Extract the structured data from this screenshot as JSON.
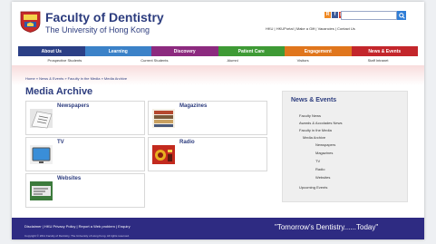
{
  "header": {
    "title": "Faculty of Dentistry",
    "subtitle": "The University of Hong Kong",
    "social_icons": [
      "rss-icon",
      "facebook-icon",
      "youtube-icon"
    ],
    "search_placeholder": "",
    "top_links": "HKU | HKUPortal | Make a Gift | Vacancies | Contact Us"
  },
  "nav": [
    {
      "label": "About Us",
      "color": "#2b3f86"
    },
    {
      "label": "Learning",
      "color": "#3b82c8"
    },
    {
      "label": "Discovery",
      "color": "#8c2a7f"
    },
    {
      "label": "Patient Care",
      "color": "#3e9a35"
    },
    {
      "label": "Engagement",
      "color": "#e0761d"
    },
    {
      "label": "News & Events",
      "color": "#c3262b"
    }
  ],
  "subnav": [
    "Prospective Students",
    "Current Students",
    "Alumni",
    "Visitors",
    "Staff Intranet"
  ],
  "breadcrumb": "Home » News & Events » Faculty in the Media » Media Archive",
  "page_title": "Media Archive",
  "cards": {
    "newspapers": "Newspapers",
    "magazines": "Magazines",
    "tv": "TV",
    "radio": "Radio",
    "websites": "Websites"
  },
  "sidebar": {
    "heading": "News & Events",
    "items": [
      "Faculty News",
      "Awards & Accolades News",
      "Faculty in the Media",
      "Media Archive",
      "Newspapers",
      "Magazines",
      "TV",
      "Radio",
      "Websites",
      "Upcoming Events"
    ]
  },
  "footer": {
    "links": "Disclaimer | HKU Privacy Policy | Report a Web problem | Enquiry",
    "copyright": "Copyright © 2011 Faculty of Dentistry, The University of Hong Kong. All rights reserved.",
    "quote": "\"Tomorrow's Dentistry......Today\""
  }
}
